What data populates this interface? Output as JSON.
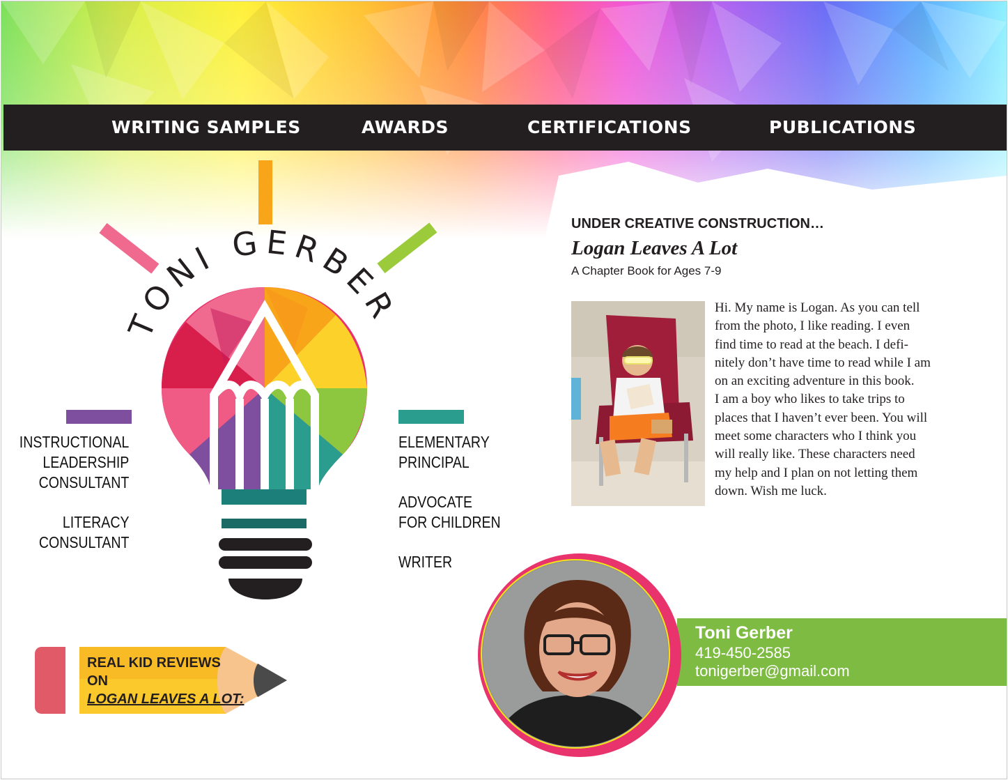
{
  "nav": {
    "items": [
      "WRITING SAMPLES",
      "AWARDS",
      "CERTIFICATIONS",
      "PUBLICATIONS"
    ]
  },
  "logo": {
    "name_letters": [
      "T",
      "O",
      "N",
      "I",
      " ",
      "G",
      "E",
      "R",
      "B",
      "E",
      "R"
    ]
  },
  "roles_left": {
    "role1": [
      "INSTRUCTIONAL",
      "LEADERSHIP",
      "CONSULTANT"
    ],
    "role2": [
      "LITERACY",
      "CONSULTANT"
    ]
  },
  "roles_right": {
    "role1": [
      "ELEMENTARY",
      "PRINCIPAL"
    ],
    "role2": [
      "ADVOCATE",
      "FOR CHILDREN"
    ],
    "role3": "WRITER"
  },
  "feature": {
    "heading": "UNDER CREATIVE CONSTRUCTION…",
    "title": "Logan Leaves A Lot",
    "subtitle": "A Chapter Book for Ages 7-9",
    "bio_lines": [
      "Hi. My name is Logan. As you can tell",
      "from the photo, I like reading. I even",
      "find time to read at the beach. I defi-",
      "nitely don’t have time to read while I am",
      "on an exciting adventure in this book.",
      "I am a boy who likes to take trips to",
      "places that I haven’t ever been. You will",
      "meet some characters who I think you",
      "will really like. These characters need",
      "my help and I plan on not letting them",
      "down. Wish me luck."
    ]
  },
  "contact": {
    "name": "Toni Gerber",
    "phone": "419-450-2585",
    "email": "tonigerber@gmail.com"
  },
  "reviews": {
    "line1": "REAL KID REVIEWS",
    "line2": "ON",
    "link": "LOGAN LEAVES A LOT:"
  },
  "colors": {
    "nav_bg": "#231f20",
    "contact_green": "#7dbb42",
    "portrait_ring": "#e8336d",
    "portrait_inner_ring": "#f2e21b",
    "purple_bar": "#7d4f9e",
    "teal_bar": "#2a9d8f"
  }
}
